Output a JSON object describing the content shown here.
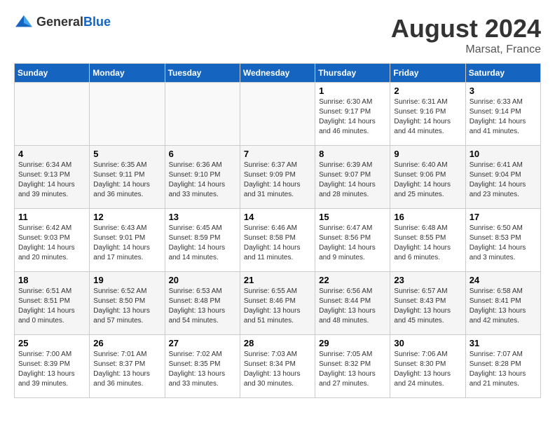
{
  "logo": {
    "general": "General",
    "blue": "Blue"
  },
  "title": "August 2024",
  "location": "Marsat, France",
  "days_of_week": [
    "Sunday",
    "Monday",
    "Tuesday",
    "Wednesday",
    "Thursday",
    "Friday",
    "Saturday"
  ],
  "weeks": [
    [
      {
        "day": "",
        "info": ""
      },
      {
        "day": "",
        "info": ""
      },
      {
        "day": "",
        "info": ""
      },
      {
        "day": "",
        "info": ""
      },
      {
        "day": "1",
        "info": "Sunrise: 6:30 AM\nSunset: 9:17 PM\nDaylight: 14 hours\nand 46 minutes."
      },
      {
        "day": "2",
        "info": "Sunrise: 6:31 AM\nSunset: 9:16 PM\nDaylight: 14 hours\nand 44 minutes."
      },
      {
        "day": "3",
        "info": "Sunrise: 6:33 AM\nSunset: 9:14 PM\nDaylight: 14 hours\nand 41 minutes."
      }
    ],
    [
      {
        "day": "4",
        "info": "Sunrise: 6:34 AM\nSunset: 9:13 PM\nDaylight: 14 hours\nand 39 minutes."
      },
      {
        "day": "5",
        "info": "Sunrise: 6:35 AM\nSunset: 9:11 PM\nDaylight: 14 hours\nand 36 minutes."
      },
      {
        "day": "6",
        "info": "Sunrise: 6:36 AM\nSunset: 9:10 PM\nDaylight: 14 hours\nand 33 minutes."
      },
      {
        "day": "7",
        "info": "Sunrise: 6:37 AM\nSunset: 9:09 PM\nDaylight: 14 hours\nand 31 minutes."
      },
      {
        "day": "8",
        "info": "Sunrise: 6:39 AM\nSunset: 9:07 PM\nDaylight: 14 hours\nand 28 minutes."
      },
      {
        "day": "9",
        "info": "Sunrise: 6:40 AM\nSunset: 9:06 PM\nDaylight: 14 hours\nand 25 minutes."
      },
      {
        "day": "10",
        "info": "Sunrise: 6:41 AM\nSunset: 9:04 PM\nDaylight: 14 hours\nand 23 minutes."
      }
    ],
    [
      {
        "day": "11",
        "info": "Sunrise: 6:42 AM\nSunset: 9:03 PM\nDaylight: 14 hours\nand 20 minutes."
      },
      {
        "day": "12",
        "info": "Sunrise: 6:43 AM\nSunset: 9:01 PM\nDaylight: 14 hours\nand 17 minutes."
      },
      {
        "day": "13",
        "info": "Sunrise: 6:45 AM\nSunset: 8:59 PM\nDaylight: 14 hours\nand 14 minutes."
      },
      {
        "day": "14",
        "info": "Sunrise: 6:46 AM\nSunset: 8:58 PM\nDaylight: 14 hours\nand 11 minutes."
      },
      {
        "day": "15",
        "info": "Sunrise: 6:47 AM\nSunset: 8:56 PM\nDaylight: 14 hours\nand 9 minutes."
      },
      {
        "day": "16",
        "info": "Sunrise: 6:48 AM\nSunset: 8:55 PM\nDaylight: 14 hours\nand 6 minutes."
      },
      {
        "day": "17",
        "info": "Sunrise: 6:50 AM\nSunset: 8:53 PM\nDaylight: 14 hours\nand 3 minutes."
      }
    ],
    [
      {
        "day": "18",
        "info": "Sunrise: 6:51 AM\nSunset: 8:51 PM\nDaylight: 14 hours\nand 0 minutes."
      },
      {
        "day": "19",
        "info": "Sunrise: 6:52 AM\nSunset: 8:50 PM\nDaylight: 13 hours\nand 57 minutes."
      },
      {
        "day": "20",
        "info": "Sunrise: 6:53 AM\nSunset: 8:48 PM\nDaylight: 13 hours\nand 54 minutes."
      },
      {
        "day": "21",
        "info": "Sunrise: 6:55 AM\nSunset: 8:46 PM\nDaylight: 13 hours\nand 51 minutes."
      },
      {
        "day": "22",
        "info": "Sunrise: 6:56 AM\nSunset: 8:44 PM\nDaylight: 13 hours\nand 48 minutes."
      },
      {
        "day": "23",
        "info": "Sunrise: 6:57 AM\nSunset: 8:43 PM\nDaylight: 13 hours\nand 45 minutes."
      },
      {
        "day": "24",
        "info": "Sunrise: 6:58 AM\nSunset: 8:41 PM\nDaylight: 13 hours\nand 42 minutes."
      }
    ],
    [
      {
        "day": "25",
        "info": "Sunrise: 7:00 AM\nSunset: 8:39 PM\nDaylight: 13 hours\nand 39 minutes."
      },
      {
        "day": "26",
        "info": "Sunrise: 7:01 AM\nSunset: 8:37 PM\nDaylight: 13 hours\nand 36 minutes."
      },
      {
        "day": "27",
        "info": "Sunrise: 7:02 AM\nSunset: 8:35 PM\nDaylight: 13 hours\nand 33 minutes."
      },
      {
        "day": "28",
        "info": "Sunrise: 7:03 AM\nSunset: 8:34 PM\nDaylight: 13 hours\nand 30 minutes."
      },
      {
        "day": "29",
        "info": "Sunrise: 7:05 AM\nSunset: 8:32 PM\nDaylight: 13 hours\nand 27 minutes."
      },
      {
        "day": "30",
        "info": "Sunrise: 7:06 AM\nSunset: 8:30 PM\nDaylight: 13 hours\nand 24 minutes."
      },
      {
        "day": "31",
        "info": "Sunrise: 7:07 AM\nSunset: 8:28 PM\nDaylight: 13 hours\nand 21 minutes."
      }
    ]
  ]
}
